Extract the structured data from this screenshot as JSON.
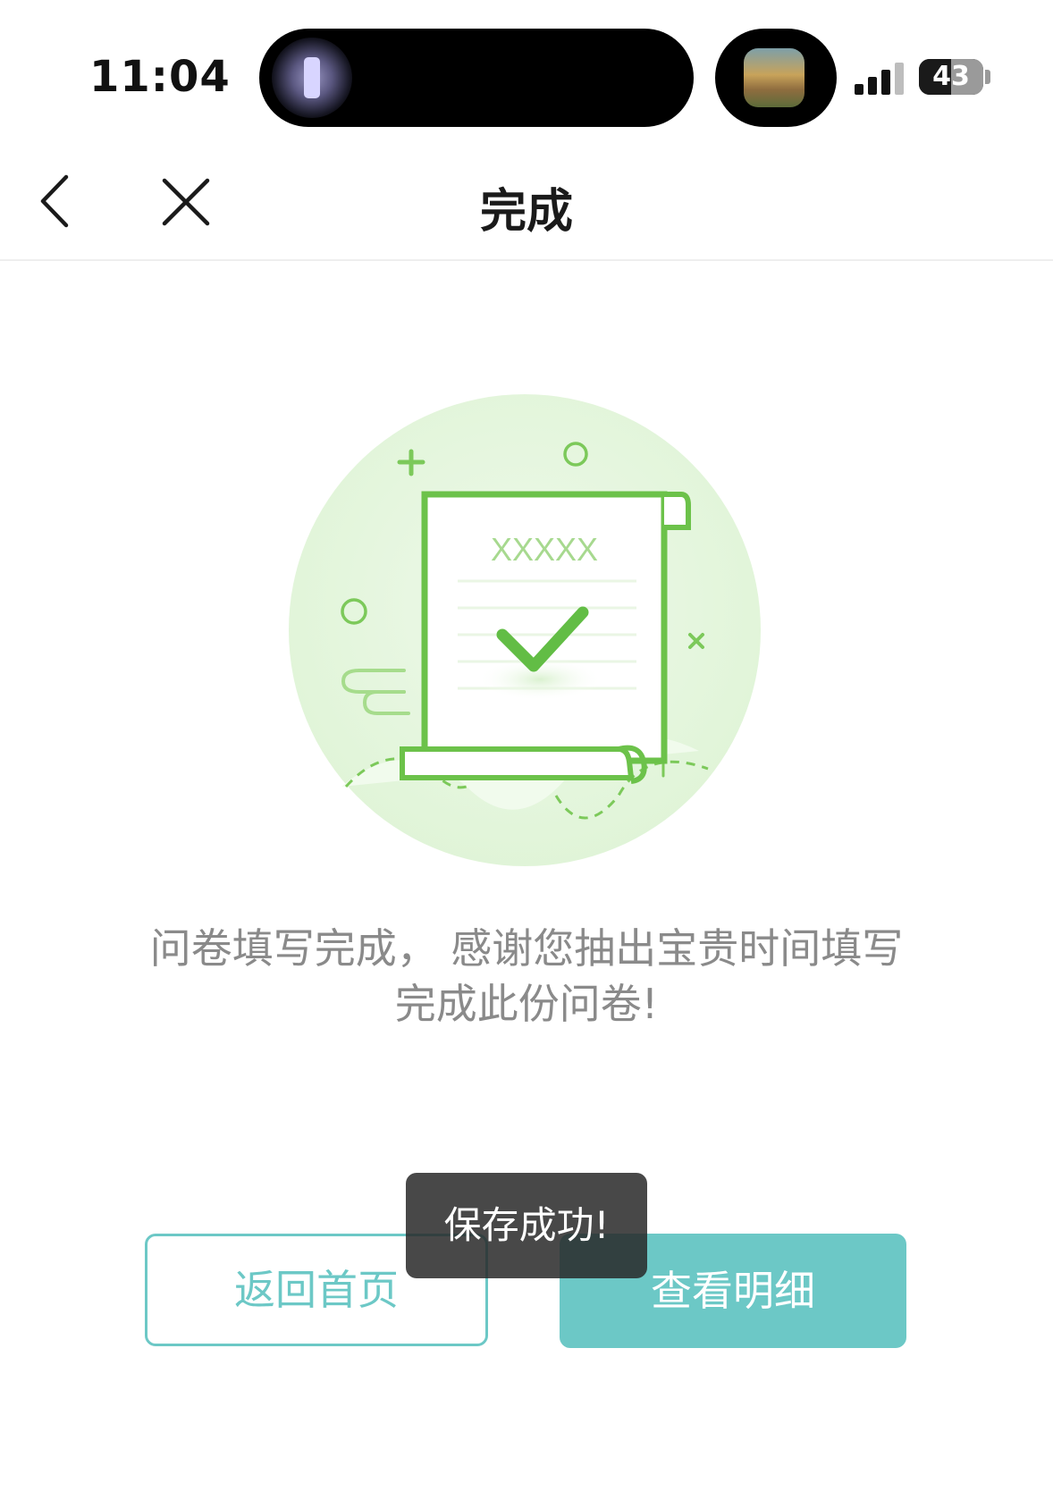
{
  "status_bar": {
    "time": "11:04",
    "battery_percent": "43",
    "signal_bars_active": 3,
    "signal_bars_total": 4
  },
  "nav": {
    "title": "完成",
    "back_icon": "chevron-left-icon",
    "close_icon": "close-icon"
  },
  "illustration": {
    "document_heading": "XXXXX",
    "check_icon": "checkmark-icon",
    "accent_color": "#6cc24a",
    "circle_color": "#e4f6dc"
  },
  "message": {
    "line1": "问卷填写完成， 感谢您抽出宝贵时间填写",
    "line2": "完成此份问卷!"
  },
  "buttons": {
    "home_label": "返回首页",
    "detail_label": "查看明细",
    "accent_color": "#6cc8c6"
  },
  "toast": {
    "text": "保存成功!"
  }
}
